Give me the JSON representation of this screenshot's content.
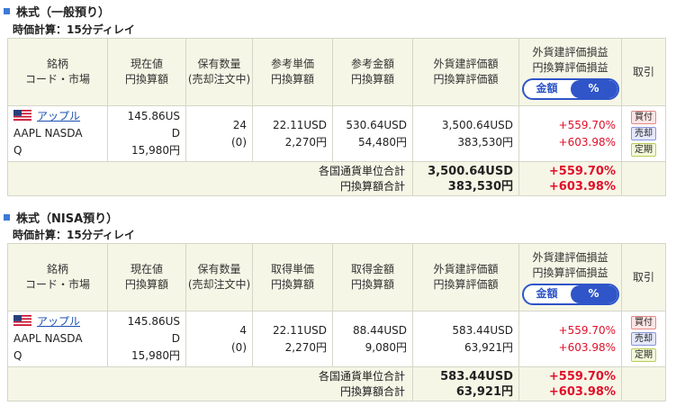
{
  "sections": [
    {
      "title": "株式（一般預り）",
      "calc_label": "時価計算：15分ディレイ",
      "headers": {
        "stock": [
          "銘柄",
          "コード・市場"
        ],
        "price": [
          "現在値",
          "円換算額"
        ],
        "qty": [
          "保有数量",
          "(売却注文中)"
        ],
        "unit": [
          "参考単価",
          "円換算額"
        ],
        "amount": [
          "参考金額",
          "円換算額"
        ],
        "valuation": [
          "外貨建評価額",
          "円換算評価額"
        ],
        "pl": [
          "外貨建評価損益",
          "円換算評価損益"
        ],
        "trade": "取引"
      },
      "toggle": {
        "amount": "金額",
        "percent": "%"
      },
      "row": {
        "name": "アップル",
        "code_market": [
          "AAPL NASDA",
          "Q"
        ],
        "price": [
          "145.86US",
          "D"
        ],
        "price_yen": "15,980円",
        "qty": "24",
        "qty_pending": "(0)",
        "unit": "22.11USD",
        "unit_yen": "2,270円",
        "amount": "530.64USD",
        "amount_yen": "54,480円",
        "valuation": "3,500.64USD",
        "valuation_yen": "383,530円",
        "pl": "+559.70%",
        "pl_yen": "+603.98%",
        "buttons": {
          "buy": "買付",
          "sell": "売却",
          "regular": "定期"
        }
      },
      "totals": {
        "currency_label": "各国通貨単位合計",
        "currency_value": "3,500.64USD",
        "currency_pl": "+559.70%",
        "yen_label": "円換算額合計",
        "yen_value": "383,530円",
        "yen_pl": "+603.98%"
      }
    },
    {
      "title": "株式（NISA預り）",
      "calc_label": "時価計算：15分ディレイ",
      "headers": {
        "stock": [
          "銘柄",
          "コード・市場"
        ],
        "price": [
          "現在値",
          "円換算額"
        ],
        "qty": [
          "保有数量",
          "(売却注文中)"
        ],
        "unit": [
          "取得単価",
          "円換算額"
        ],
        "amount": [
          "取得金額",
          "円換算額"
        ],
        "valuation": [
          "外貨建評価額",
          "円換算評価額"
        ],
        "pl": [
          "外貨建評価損益",
          "円換算評価損益"
        ],
        "trade": "取引"
      },
      "toggle": {
        "amount": "金額",
        "percent": "%"
      },
      "row": {
        "name": "アップル",
        "code_market": [
          "AAPL NASDA",
          "Q"
        ],
        "price": [
          "145.86US",
          "D"
        ],
        "price_yen": "15,980円",
        "qty": "4",
        "qty_pending": "(0)",
        "unit": "22.11USD",
        "unit_yen": "2,270円",
        "amount": "88.44USD",
        "amount_yen": "9,080円",
        "valuation": "583.44USD",
        "valuation_yen": "63,921円",
        "pl": "+559.70%",
        "pl_yen": "+603.98%",
        "buttons": {
          "buy": "買付",
          "sell": "売却",
          "regular": "定期"
        }
      },
      "totals": {
        "currency_label": "各国通貨単位合計",
        "currency_value": "583.44USD",
        "currency_pl": "+559.70%",
        "yen_label": "円換算額合計",
        "yen_value": "63,921円",
        "yen_pl": "+603.98%"
      }
    }
  ],
  "colors": {
    "accent": "#2f55c8",
    "gain": "#e0102a",
    "header_bg": "#f6f6e6",
    "link": "#1a4fb0"
  }
}
